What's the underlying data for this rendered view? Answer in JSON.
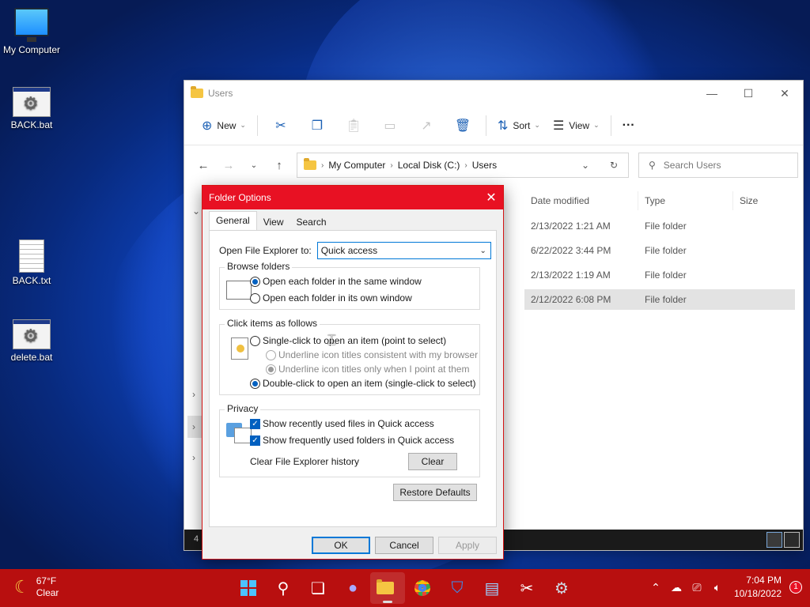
{
  "desktop": {
    "icons": [
      {
        "label": "My Computer"
      },
      {
        "label": "BACK.bat"
      },
      {
        "label": "BACK.txt"
      },
      {
        "label": "delete.bat"
      }
    ]
  },
  "explorer": {
    "title": "Users",
    "toolbar": {
      "new_label": "New",
      "sort_label": "Sort",
      "view_label": "View",
      "more_label": "···"
    },
    "breadcrumb": [
      "My Computer",
      "Local Disk (C:)",
      "Users"
    ],
    "search_placeholder": "Search Users",
    "columns": [
      "Date modified",
      "Type",
      "Size"
    ],
    "rows": [
      {
        "date": "2/13/2022 1:21 AM",
        "type": "File folder"
      },
      {
        "date": "6/22/2022 3:44 PM",
        "type": "File folder"
      },
      {
        "date": "2/13/2022 1:19 AM",
        "type": "File folder"
      },
      {
        "date": "2/12/2022 6:08 PM",
        "type": "File folder"
      }
    ],
    "status_count": "4"
  },
  "dialog": {
    "title": "Folder Options",
    "close": "✕",
    "tabs": [
      "General",
      "View",
      "Search"
    ],
    "open_label": "Open File Explorer to:",
    "open_value": "Quick access",
    "browse": {
      "title": "Browse folders",
      "opt1": "Open each folder in the same window",
      "opt2": "Open each folder in its own window"
    },
    "click": {
      "title": "Click items as follows",
      "opt1": "Single-click to open an item (point to select)",
      "sub1": "Underline icon titles consistent with my browser",
      "sub2": "Underline icon titles only when I point at them",
      "opt2": "Double-click to open an item (single-click to select)"
    },
    "privacy": {
      "title": "Privacy",
      "chk1": "Show recently used files in Quick access",
      "chk2": "Show frequently used folders in Quick access",
      "clear_label": "Clear File Explorer history",
      "clear_button": "Clear"
    },
    "restore_button": "Restore Defaults",
    "ok": "OK",
    "cancel": "Cancel",
    "apply": "Apply"
  },
  "taskbar": {
    "temp": "67°F",
    "condition": "Clear",
    "time": "7:04 PM",
    "date": "10/18/2022",
    "notifications": "1"
  },
  "colors": {
    "taskbar": "#b80f0f",
    "dialog_title": "#e81123",
    "accent": "#0060c0"
  }
}
